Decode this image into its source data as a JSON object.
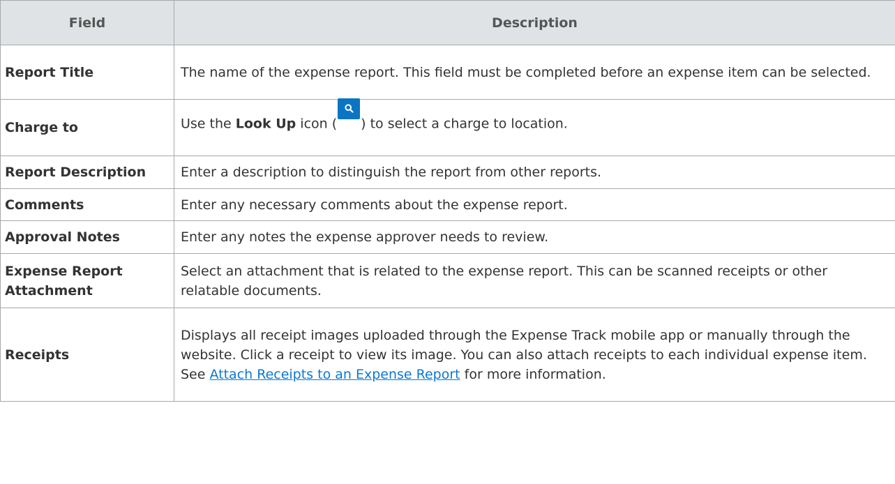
{
  "table": {
    "headers": {
      "field": "Field",
      "description": "Description"
    },
    "rows": {
      "report_title": {
        "field": "Report Title",
        "description": "The name of the expense report. This field must be completed before an expense item can be selected."
      },
      "charge_to": {
        "field": "Charge to",
        "desc_before": "Use the ",
        "desc_bold": "Look Up",
        "desc_mid": " icon (",
        "icon": "search-icon",
        "icon_color": "#0a75c2",
        "desc_after": ") to select a charge to location."
      },
      "report_description": {
        "field": "Report Description",
        "description": "Enter a description to distinguish the report from other reports."
      },
      "comments": {
        "field": "Comments",
        "description": "Enter any necessary comments about the expense report."
      },
      "approval_notes": {
        "field": "Approval Notes",
        "description": "Enter any notes the expense approver needs to review."
      },
      "expense_report_attachment": {
        "field": "Expense Report Attachment",
        "description": "Select an attachment that is related to the expense report. This can be scanned receipts or other relatable documents."
      },
      "receipts": {
        "field": "Receipts",
        "desc_before": "Displays all receipt images uploaded through the Expense Track mobile app or manually through the website. Click a receipt to view its image. You can also attach receipts to each individual expense item. See ",
        "link_text": "Attach Receipts to an Expense Report",
        "desc_after": " for more information."
      }
    }
  },
  "colors": {
    "header_bg": "#dfe3e6",
    "border": "#a8a8a8",
    "link": "#0b78d1"
  }
}
